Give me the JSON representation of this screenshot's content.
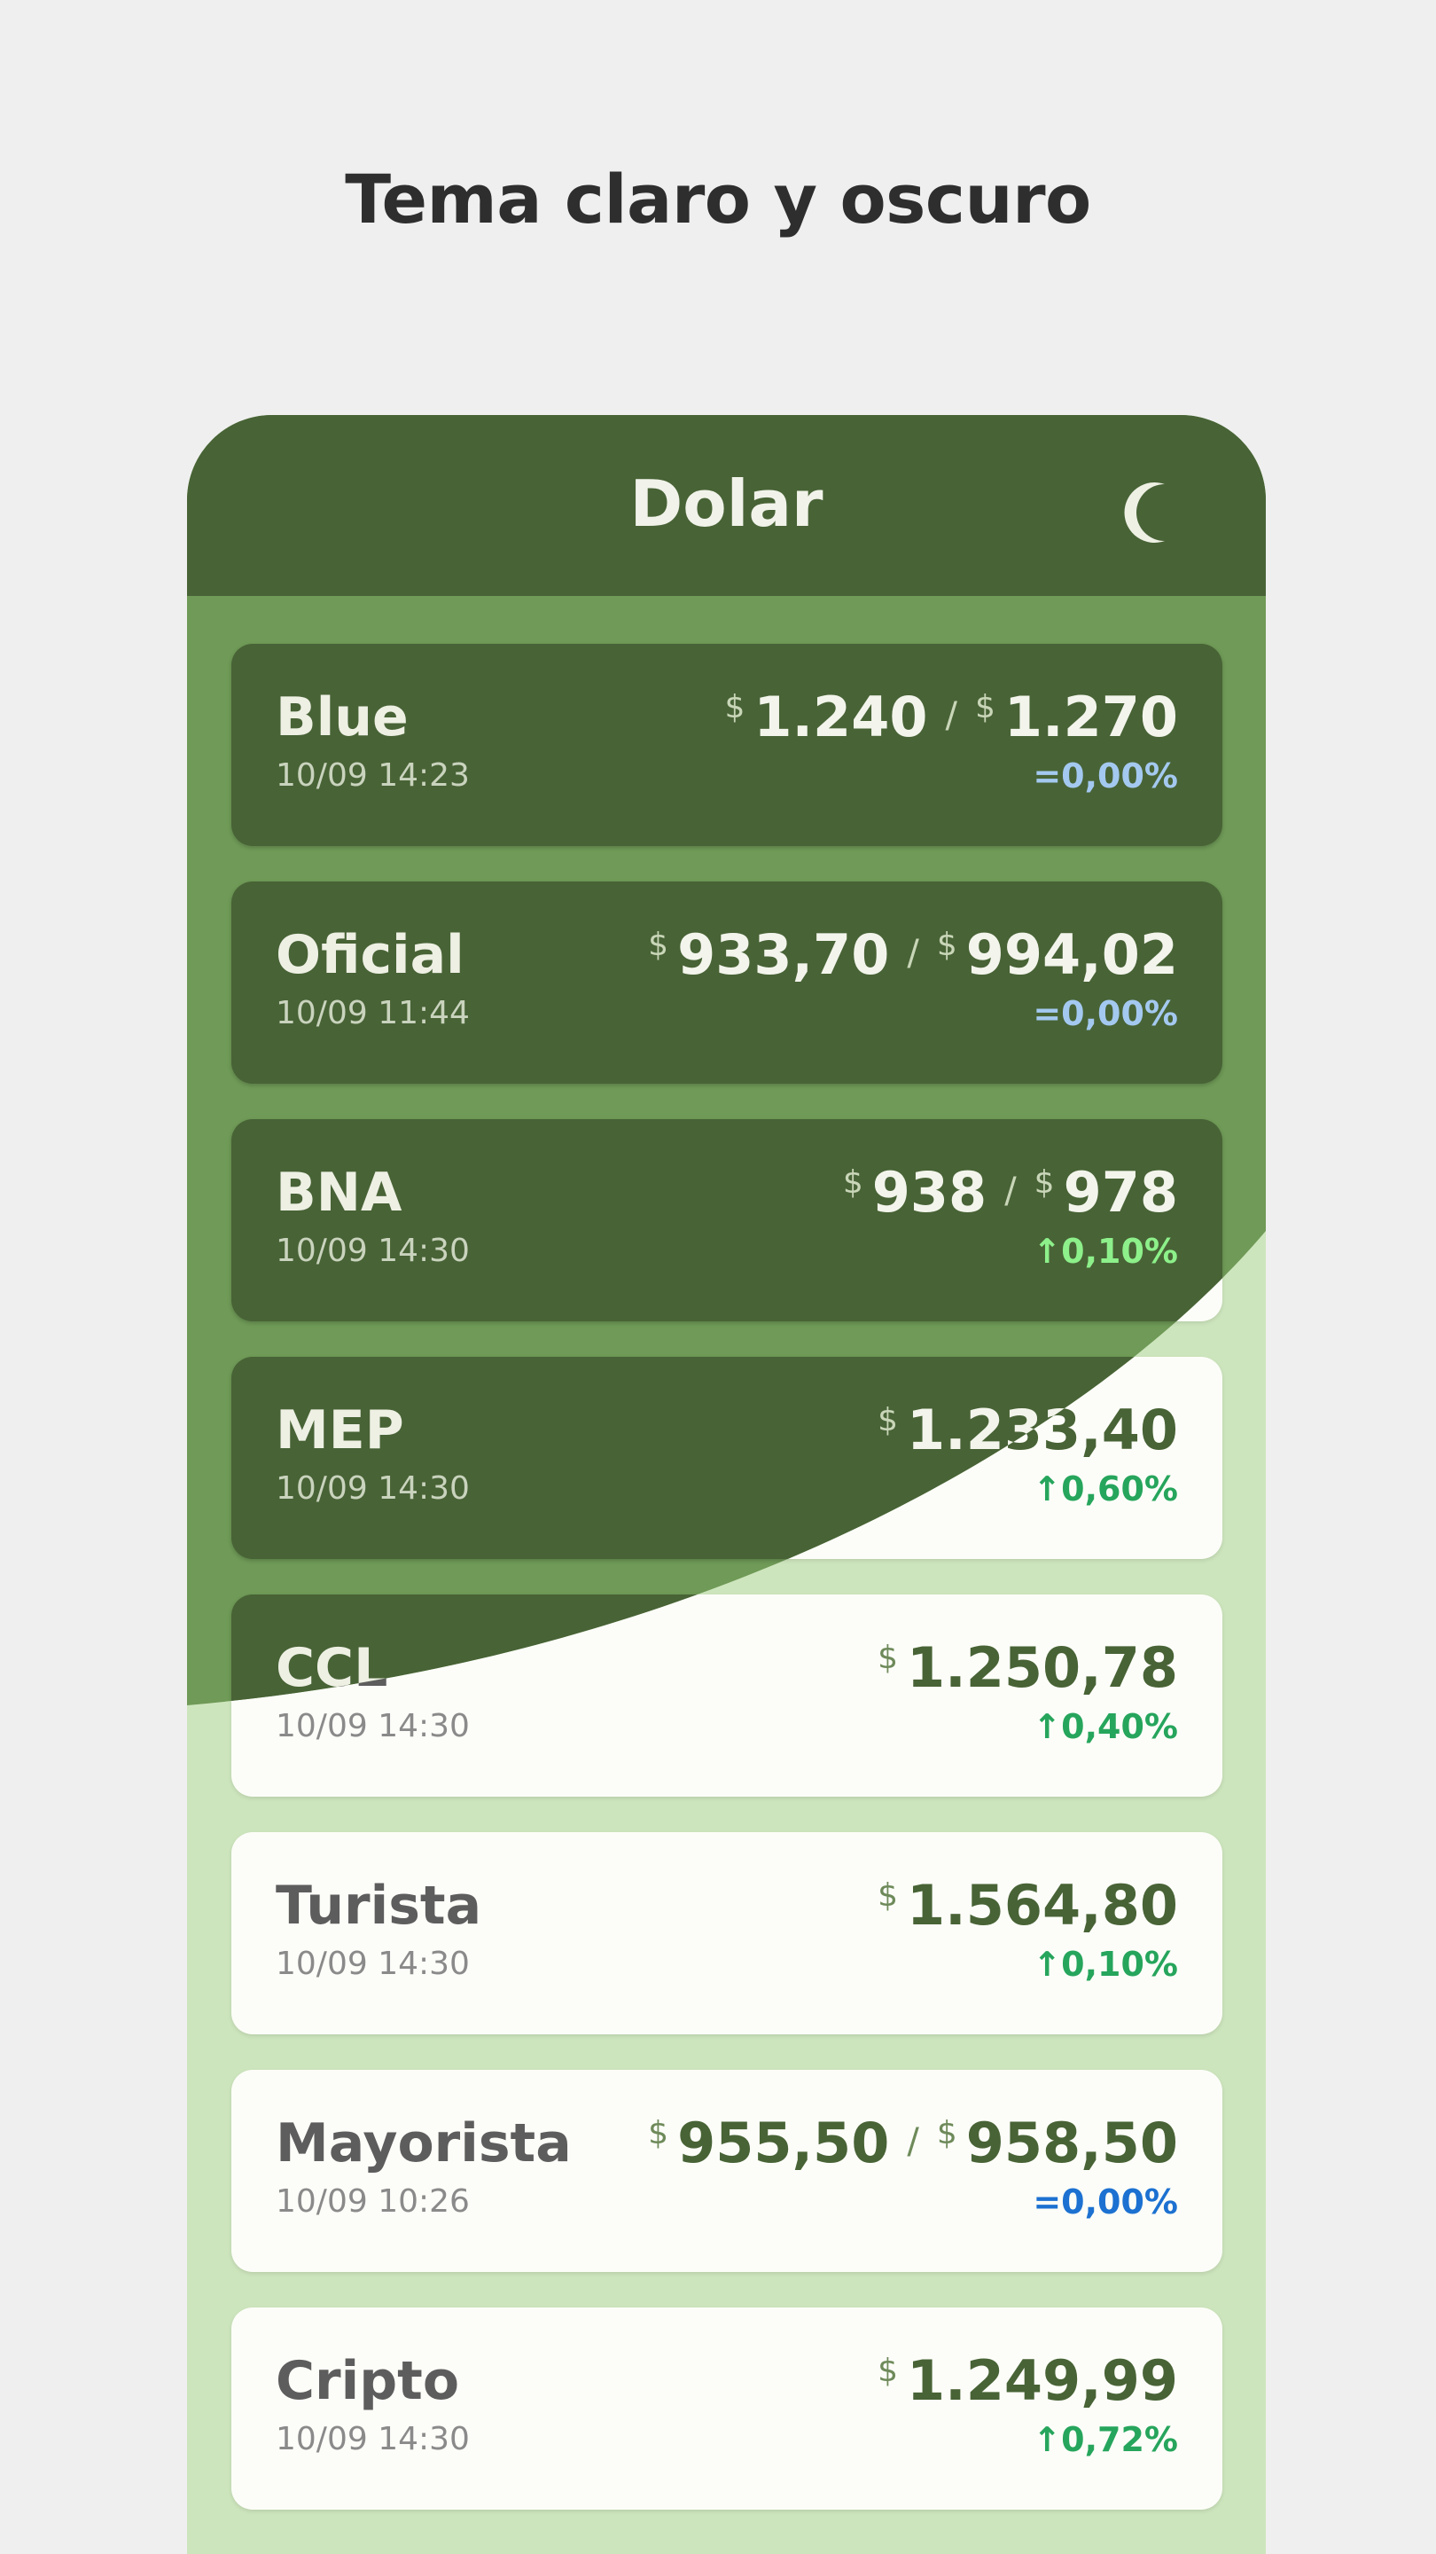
{
  "headline": "Tema claro y oscuro",
  "app": {
    "title": "Dolar",
    "theme_toggle_icon": "moon-icon"
  },
  "colors": {
    "primary_dark": "#486336",
    "primary_light": "#6f9a57",
    "light_background": "#cde5bd",
    "up": "#26a55c",
    "flat": "#1c71d1"
  },
  "rates": [
    {
      "name": "Blue",
      "time": "10/09 14:23",
      "currency": "$",
      "buy": "1.240",
      "sell": "1.270",
      "separator": "/",
      "change_symbol": "=",
      "change": "0,00%",
      "trend": "flat"
    },
    {
      "name": "Oficial",
      "time": "10/09 11:44",
      "currency": "$",
      "buy": "933,70",
      "sell": "994,02",
      "separator": "/",
      "change_symbol": "=",
      "change": "0,00%",
      "trend": "flat"
    },
    {
      "name": "BNA",
      "time": "10/09 14:30",
      "currency": "$",
      "buy": "938",
      "sell": "978",
      "separator": "/",
      "change_symbol": "↑",
      "change": "0,10%",
      "trend": "up"
    },
    {
      "name": "MEP",
      "time": "10/09 14:30",
      "currency": "$",
      "value": "1.233,40",
      "change_symbol": "↑",
      "change": "0,60%",
      "trend": "up"
    },
    {
      "name": "CCL",
      "time": "10/09 14:30",
      "currency": "$",
      "value": "1.250,78",
      "change_symbol": "↑",
      "change": "0,40%",
      "trend": "up"
    },
    {
      "name": "Turista",
      "time": "10/09 14:30",
      "currency": "$",
      "value": "1.564,80",
      "change_symbol": "↑",
      "change": "0,10%",
      "trend": "up"
    },
    {
      "name": "Mayorista",
      "time": "10/09 10:26",
      "currency": "$",
      "buy": "955,50",
      "sell": "958,50",
      "separator": "/",
      "change_symbol": "=",
      "change": "0,00%",
      "trend": "flat"
    },
    {
      "name": "Cripto",
      "time": "10/09 14:30",
      "currency": "$",
      "value": "1.249,99",
      "change_symbol": "↑",
      "change": "0,72%",
      "trend": "up"
    }
  ]
}
